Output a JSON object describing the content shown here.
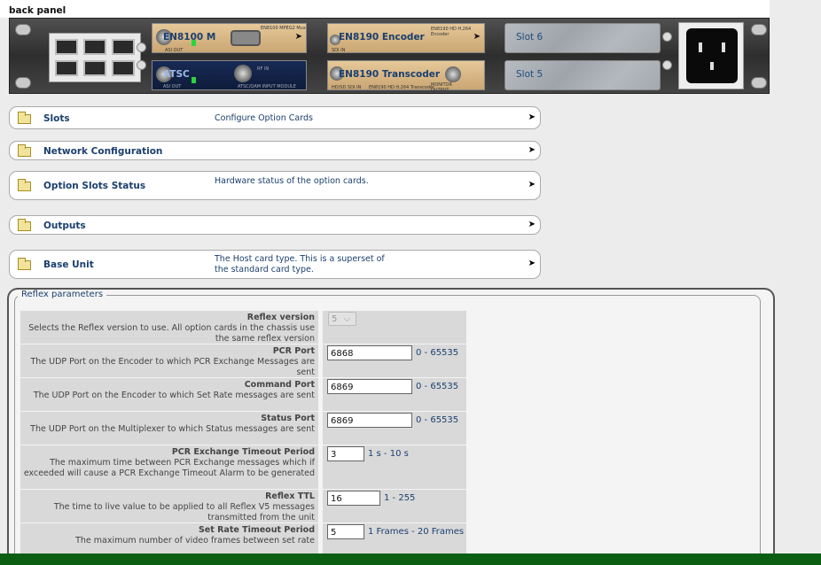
{
  "back_panel": {
    "title": "back panel",
    "cards": {
      "en8100": "EN8100 M",
      "en8190_encoder": "EN8190 Encoder",
      "slot6": "Slot 6",
      "atsc": "ATSC",
      "en8190_transcoder": "EN8190 Transcoder",
      "slot5": "Slot 5"
    },
    "fine_print": {
      "en8100_top": "EN8100 MPEG2 Mux",
      "en8100_bottom": "ASI OUT",
      "atsc_top": "RF IN",
      "atsc_bottom": "ATSC/QAM INPUT MODULE",
      "atsc_left": "ASI OUT",
      "enc_tag": "EN8190 HD H.264 Encoder",
      "enc_left": "SDI IN",
      "trans_left": "HD/SD SDI IN",
      "trans_bottom": "MONITOR OUTPUT",
      "trans_tag": "EN8190 HD H.264 Transcoder"
    }
  },
  "nav_rows": [
    {
      "label": "Slots",
      "desc": "Configure Option Cards"
    },
    {
      "label": "Network Configuration",
      "desc": ""
    },
    {
      "label": "Option Slots Status",
      "desc": "Hardware status of the option cards."
    },
    {
      "label": "Outputs",
      "desc": ""
    },
    {
      "label": "Base Unit",
      "desc": "The Host card type. This is a superset of the standard card type."
    }
  ],
  "reflex": {
    "legend": "Reflex parameters",
    "params": [
      {
        "name": "Reflex version",
        "help": "Selects the Reflex version to use. All option cards in the chassis use the same reflex version",
        "value": "5",
        "range": ""
      },
      {
        "name": "PCR Port",
        "help": "The UDP Port on the Encoder to which PCR Exchange Messages are sent",
        "value": "6868",
        "range": "0 - 65535"
      },
      {
        "name": "Command Port",
        "help": "The UDP Port on the Encoder to which Set Rate messages are sent",
        "value": "6869",
        "range": "0 - 65535"
      },
      {
        "name": "Status Port",
        "help": "The UDP Port on the Multiplexer to which Status messages are sent",
        "value": "6869",
        "range": "0 - 65535"
      },
      {
        "name": "PCR Exchange Timeout Period",
        "help": "The maximum time between PCR Exchange messages which if exceeded will cause a PCR Exchange Timeout Alarm to be generated",
        "value": "3",
        "range": "1 s - 10 s"
      },
      {
        "name": "Reflex TTL",
        "help": "The time to live value to be applied to all Reflex V5 messages transmitted from the unit",
        "value": "16",
        "range": "1 - 255"
      },
      {
        "name": "Set Rate Timeout Period",
        "help": "The maximum number of video frames between set rate",
        "value": "5",
        "range": "1 Frames - 20 Frames"
      }
    ]
  }
}
